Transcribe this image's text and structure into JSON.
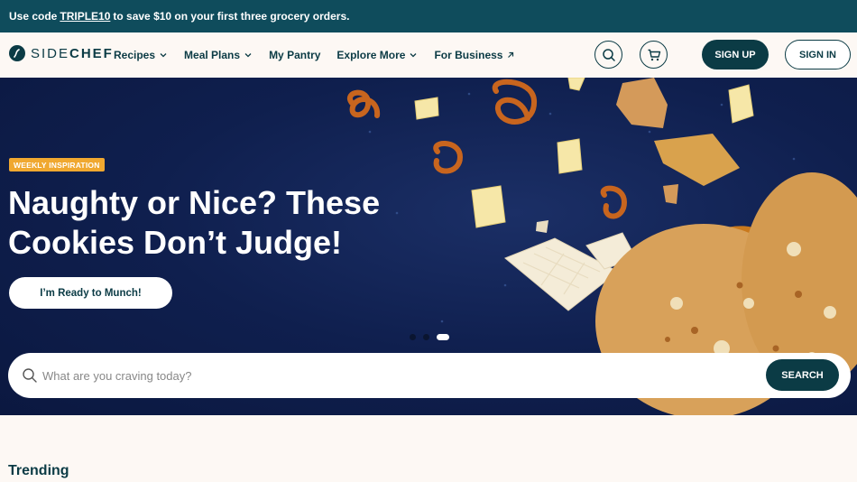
{
  "promo": {
    "prefix": "Use code",
    "code": "TRIPLE10",
    "suffix": "to save $10 on your first three grocery orders."
  },
  "nav": {
    "logo_text_light": "SIDE",
    "logo_text_bold": "CHEF",
    "items": [
      {
        "label": "Recipes",
        "icon": "chevron-down-icon"
      },
      {
        "label": "Meal Plans",
        "icon": "chevron-down-icon"
      },
      {
        "label": "My Pantry",
        "icon": ""
      },
      {
        "label": "Explore More",
        "icon": "chevron-down-icon"
      },
      {
        "label": "For Business",
        "icon": "arrow-up-right-icon"
      }
    ],
    "search_icon": "search-icon",
    "cart_icon": "cart-icon",
    "signup_label": "SIGN UP",
    "signin_label": "SIGN IN"
  },
  "hero": {
    "badge": "WEEKLY INSPIRATION",
    "headline": "Naughty or Nice? These Cookies Don’t Judge!",
    "cta_label": "I’m Ready to Munch!",
    "slides_count": 3,
    "active_slide": 3
  },
  "search": {
    "placeholder": "What are you craving today?",
    "button_label": "SEARCH"
  },
  "trending": {
    "title": "Trending"
  },
  "colors": {
    "brand": "#0b3b45",
    "promo_bg": "#0f4c5c",
    "hero_bg": "#0f1f4e",
    "badge": "#f0a830",
    "page_bg": "#fdf8f4"
  }
}
